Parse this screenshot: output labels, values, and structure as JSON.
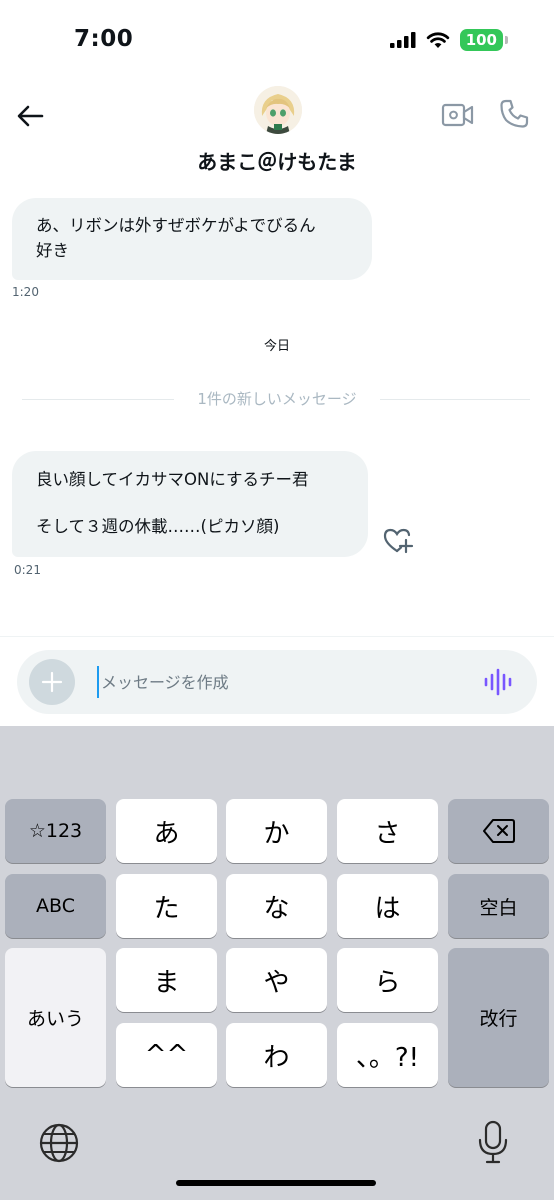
{
  "status_bar": {
    "time": "7:00",
    "battery": "100"
  },
  "header": {
    "name": "あまこ＠けもたま"
  },
  "messages": [
    {
      "lines": [
        "あ、リボンは外すぜボケがよでびるん",
        "好き"
      ],
      "time": "1:20"
    },
    {
      "lines": [
        "良い顔してイカサマONにするチー君",
        "そして３週の休載……(ピカソ顔)"
      ],
      "time": "0:21"
    }
  ],
  "day_label": "今日",
  "divider_label": "1件の新しいメッセージ",
  "composer": {
    "placeholder": "メッセージを作成"
  },
  "keyboard": {
    "row1": [
      "☆123",
      "あ",
      "か",
      "さ"
    ],
    "row2": [
      "ABC",
      "た",
      "な",
      "は",
      "空白"
    ],
    "row3": [
      "あいう",
      "ま",
      "や",
      "ら",
      "改行"
    ],
    "row4": [
      "^^",
      "わ",
      "、。?!"
    ]
  },
  "icons": [
    "back-arrow-icon",
    "video-icon",
    "phone-icon",
    "heart-plus-icon",
    "plus-icon",
    "voice-wave-icon",
    "delete-icon",
    "globe-icon",
    "mic-icon",
    "signal-icon",
    "wifi-icon"
  ],
  "colors": {
    "accent": "#1d9bf0",
    "voice": "#7856ff",
    "battery": "#34c759",
    "bubble": "#eff3f4"
  }
}
